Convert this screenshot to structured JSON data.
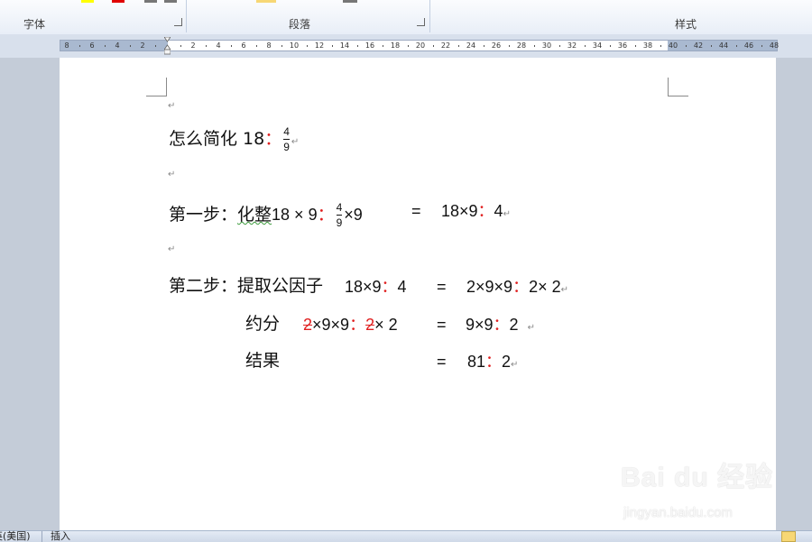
{
  "ribbon": {
    "groups": [
      {
        "label": "字体"
      },
      {
        "label": "段落"
      },
      {
        "label": "样式"
      }
    ]
  },
  "ruler": {
    "left_labels": [
      "8",
      "6",
      "4",
      "2"
    ],
    "right_labels": [
      "2",
      "4",
      "6",
      "8",
      "10",
      "12",
      "14",
      "16",
      "18",
      "20",
      "22",
      "24",
      "26",
      "28",
      "30",
      "32",
      "34",
      "36",
      "38",
      "40",
      "42",
      "44",
      "46",
      "48"
    ]
  },
  "document": {
    "pilcrow": "↵",
    "title": {
      "prefix": "怎么简化 18",
      "sep": "：",
      "frac_num": "4",
      "frac_den": "9"
    },
    "step1": {
      "label": "第一步：",
      "word": "化整",
      "expr1": "18 × 9",
      "sep": "：",
      "frac_num": "4",
      "frac_den": "9",
      "expr1_tail": "×9",
      "eq": "=",
      "rhs_a": "18×9",
      "rhs_b": "4"
    },
    "step2": {
      "label": "第二步：",
      "word": "提取公因子",
      "lhs_a": "18×9",
      "lhs_b": "4",
      "eq": "=",
      "rhs_a": "2×9×9",
      "rhs_b": "2× 2"
    },
    "reduce": {
      "label": "约分",
      "two_a": "2",
      "mid": "×9×9",
      "two_b": "2",
      "tail": "× 2",
      "eq": "=",
      "rhs_a": "9×9",
      "rhs_b": "2"
    },
    "result": {
      "label": "结果",
      "eq": "=",
      "rhs_a": "81",
      "rhs_b": "2"
    },
    "colon": "："
  },
  "status": {
    "lang": "英(美国)",
    "mode": "插入"
  },
  "watermark": {
    "brand": "Bai du 经验",
    "url": "jingyan.baidu.com"
  }
}
